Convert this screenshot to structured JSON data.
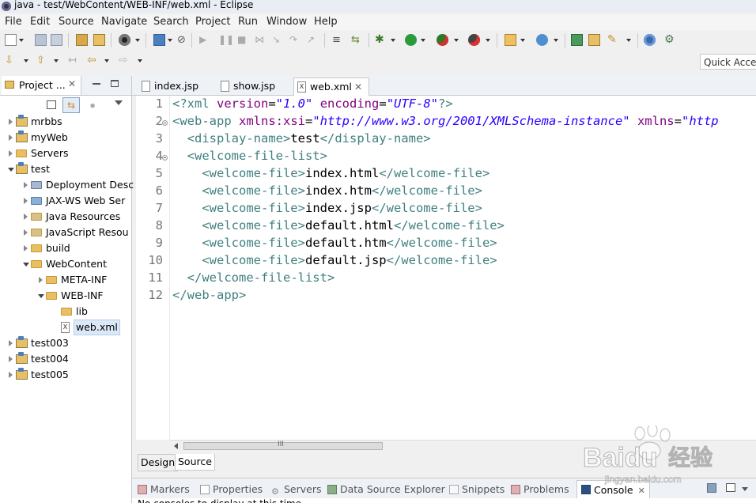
{
  "window": {
    "title": "java - test/WebContent/WEB-INF/web.xml - Eclipse"
  },
  "menu": [
    "File",
    "Edit",
    "Source",
    "Navigate",
    "Search",
    "Project",
    "Run",
    "Window",
    "Help"
  ],
  "quick_access": {
    "placeholder": "Quick Access"
  },
  "left_panel": {
    "tab_label": "Project ...",
    "tree": [
      {
        "label": "mrbbs",
        "level": 0,
        "expanded": false,
        "type": "project"
      },
      {
        "label": "myWeb",
        "level": 0,
        "expanded": false,
        "type": "project"
      },
      {
        "label": "Servers",
        "level": 0,
        "expanded": false,
        "type": "folder"
      },
      {
        "label": "test",
        "level": 0,
        "expanded": true,
        "type": "project"
      },
      {
        "label": "Deployment Desc",
        "level": 1,
        "expanded": false,
        "type": "descriptor"
      },
      {
        "label": "JAX-WS Web Ser",
        "level": 1,
        "expanded": false,
        "type": "ws"
      },
      {
        "label": "Java Resources",
        "level": 1,
        "expanded": false,
        "type": "resources"
      },
      {
        "label": "JavaScript Resou",
        "level": 1,
        "expanded": false,
        "type": "resources"
      },
      {
        "label": "build",
        "level": 1,
        "expanded": false,
        "type": "folder"
      },
      {
        "label": "WebContent",
        "level": 1,
        "expanded": true,
        "type": "folder"
      },
      {
        "label": "META-INF",
        "level": 2,
        "expanded": false,
        "type": "folder"
      },
      {
        "label": "WEB-INF",
        "level": 2,
        "expanded": true,
        "type": "folder"
      },
      {
        "label": "lib",
        "level": 3,
        "expanded": null,
        "type": "folder"
      },
      {
        "label": "web.xml",
        "level": 3,
        "expanded": null,
        "type": "xml",
        "selected": true
      },
      {
        "label": "test003",
        "level": 0,
        "expanded": false,
        "type": "project"
      },
      {
        "label": "test004",
        "level": 0,
        "expanded": false,
        "type": "project"
      },
      {
        "label": "test005",
        "level": 0,
        "expanded": false,
        "type": "project"
      }
    ]
  },
  "editor": {
    "tabs": [
      {
        "label": "index.jsp",
        "active": false
      },
      {
        "label": "show.jsp",
        "active": false
      },
      {
        "label": "web.xml",
        "active": true
      }
    ],
    "line_numbers": [
      "1",
      "2",
      "3",
      "4",
      "5",
      "6",
      "7",
      "8",
      "9",
      "10",
      "11",
      "12"
    ],
    "lines": [
      [
        {
          "c": "tag",
          "t": "<?xml "
        },
        {
          "c": "attr",
          "t": "version"
        },
        {
          "c": "txt",
          "t": "="
        },
        {
          "c": "val",
          "t": "\"1.0\""
        },
        {
          "c": "txt",
          "t": " "
        },
        {
          "c": "attr",
          "t": "encoding"
        },
        {
          "c": "txt",
          "t": "="
        },
        {
          "c": "val",
          "t": "\"UTF-8\""
        },
        {
          "c": "tag",
          "t": "?>"
        }
      ],
      [
        {
          "c": "tag",
          "t": "<web-app "
        },
        {
          "c": "attr",
          "t": "xmlns:xsi"
        },
        {
          "c": "txt",
          "t": "="
        },
        {
          "c": "val",
          "t": "\"http://www.w3.org/2001/XMLSchema-instance\""
        },
        {
          "c": "txt",
          "t": " "
        },
        {
          "c": "attr",
          "t": "xmlns"
        },
        {
          "c": "txt",
          "t": "="
        },
        {
          "c": "val",
          "t": "\"http"
        }
      ],
      [
        {
          "c": "txt",
          "t": "  "
        },
        {
          "c": "tag",
          "t": "<display-name>"
        },
        {
          "c": "txt",
          "t": "test"
        },
        {
          "c": "tag",
          "t": "</display-name>"
        }
      ],
      [
        {
          "c": "txt",
          "t": "  "
        },
        {
          "c": "tag",
          "t": "<welcome-file-list>"
        }
      ],
      [
        {
          "c": "txt",
          "t": "    "
        },
        {
          "c": "tag",
          "t": "<welcome-file>"
        },
        {
          "c": "txt",
          "t": "index.html"
        },
        {
          "c": "tag",
          "t": "</welcome-file>"
        }
      ],
      [
        {
          "c": "txt",
          "t": "    "
        },
        {
          "c": "tag",
          "t": "<welcome-file>"
        },
        {
          "c": "txt",
          "t": "index.htm"
        },
        {
          "c": "tag",
          "t": "</welcome-file>"
        }
      ],
      [
        {
          "c": "txt",
          "t": "    "
        },
        {
          "c": "tag",
          "t": "<welcome-file>"
        },
        {
          "c": "txt",
          "t": "index.jsp"
        },
        {
          "c": "tag",
          "t": "</welcome-file>"
        }
      ],
      [
        {
          "c": "txt",
          "t": "    "
        },
        {
          "c": "tag",
          "t": "<welcome-file>"
        },
        {
          "c": "txt",
          "t": "default.html"
        },
        {
          "c": "tag",
          "t": "</welcome-file>"
        }
      ],
      [
        {
          "c": "txt",
          "t": "    "
        },
        {
          "c": "tag",
          "t": "<welcome-file>"
        },
        {
          "c": "txt",
          "t": "default.htm"
        },
        {
          "c": "tag",
          "t": "</welcome-file>"
        }
      ],
      [
        {
          "c": "txt",
          "t": "    "
        },
        {
          "c": "tag",
          "t": "<welcome-file>"
        },
        {
          "c": "txt",
          "t": "default.jsp"
        },
        {
          "c": "tag",
          "t": "</welcome-file>"
        }
      ],
      [
        {
          "c": "txt",
          "t": "  "
        },
        {
          "c": "tag",
          "t": "</welcome-file-list>"
        }
      ],
      [
        {
          "c": "tag",
          "t": "</web-app>"
        }
      ]
    ],
    "scroll_mark": "III",
    "bottom_tabs": [
      "Design",
      "Source"
    ]
  },
  "bottom_panel": {
    "tabs": [
      {
        "label": "Markers",
        "active": false
      },
      {
        "label": "Properties",
        "active": false
      },
      {
        "label": "Servers",
        "active": false
      },
      {
        "label": "Data Source Explorer",
        "active": false
      },
      {
        "label": "Snippets",
        "active": false
      },
      {
        "label": "Problems",
        "active": false
      },
      {
        "label": "Console",
        "active": true
      }
    ],
    "message": "No consoles to display at this time."
  },
  "watermark": {
    "brand": "Baidu",
    "brand_cn": "经验",
    "url": "jingyan.baidu.com"
  },
  "colors": {
    "tag": "#3f7f7f",
    "attr": "#7f007f",
    "value": "#2a00ff",
    "selection": "#dbe8f8"
  }
}
